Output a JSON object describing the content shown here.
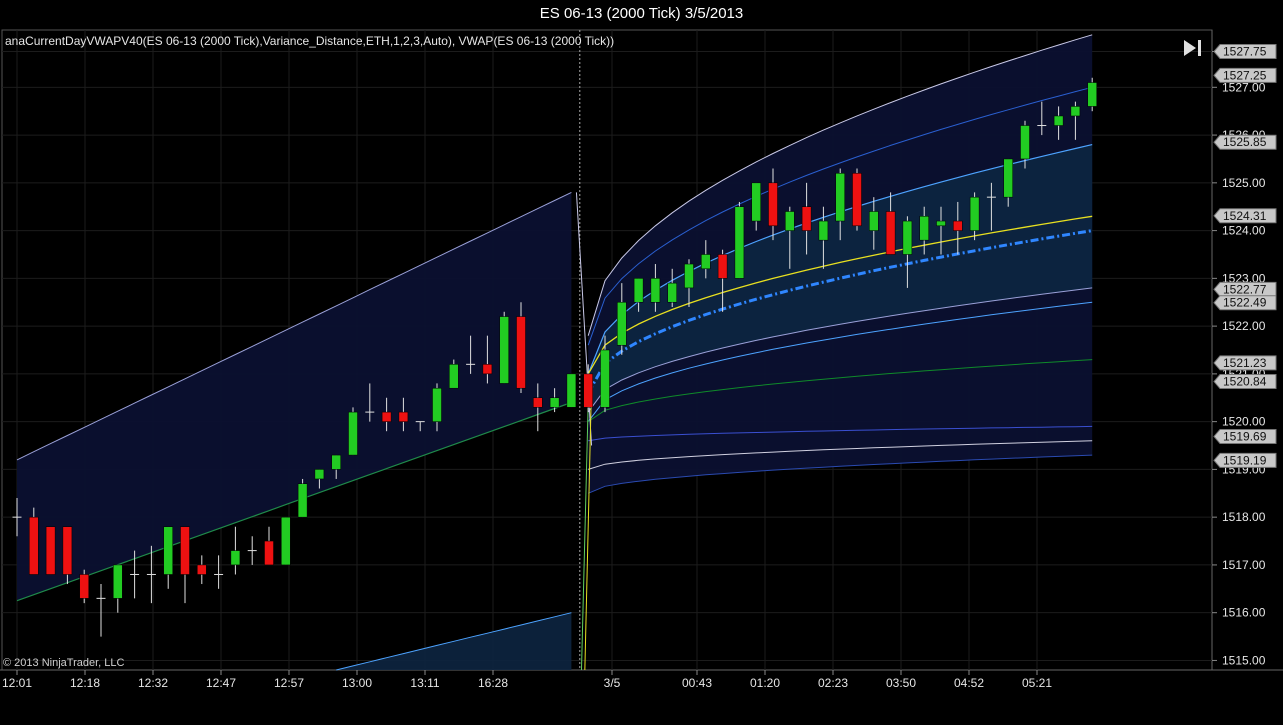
{
  "window": {
    "title": "ES 06-13 (2000 Tick)  3/5/2013"
  },
  "indicator_label": "anaCurrentDayVWAPV40(ES 06-13 (2000 Tick),Variance_Distance,ETH,1,2,3,Auto), VWAP(ES 06-13 (2000 Tick))",
  "copyright": "© 2013 NinjaTrader, LLC",
  "icons": {
    "scroll_end": "skip-to-end-icon"
  },
  "colors": {
    "background": "#000000",
    "up_candle": "#22cc22",
    "down_candle": "#ee1111",
    "vwap": "#2f86ff",
    "vwap_yellow": "#e8e020",
    "band_fill": "#0b1030",
    "inner_fill": "#0d2540"
  },
  "chart_data": {
    "type": "candlestick",
    "title": "ES 06-13 (2000 Tick)  3/5/2013",
    "ylim": [
      1514.8,
      1528.2
    ],
    "y_ticks": [
      "1515.00",
      "1516.00",
      "1517.00",
      "1518.00",
      "1519.00",
      "1520.00",
      "1521.00",
      "1522.00",
      "1523.00",
      "1524.00",
      "1525.00",
      "1526.00",
      "1527.00",
      "1527.75"
    ],
    "x_ticks": [
      "12:01",
      "12:18",
      "12:32",
      "12:47",
      "12:57",
      "13:00",
      "13:11",
      "16:28",
      "3/5",
      "00:43",
      "01:20",
      "02:23",
      "03:50",
      "04:52",
      "05:21"
    ],
    "session_break_index": 33.5,
    "candles": [
      {
        "o": 1518.0,
        "h": 1518.4,
        "l": 1517.6,
        "c": 1518.0
      },
      {
        "o": 1518.0,
        "h": 1518.2,
        "l": 1516.8,
        "c": 1516.8
      },
      {
        "o": 1517.8,
        "h": 1517.8,
        "l": 1516.8,
        "c": 1516.8
      },
      {
        "o": 1517.8,
        "h": 1517.8,
        "l": 1516.6,
        "c": 1516.8
      },
      {
        "o": 1516.8,
        "h": 1516.9,
        "l": 1516.2,
        "c": 1516.3
      },
      {
        "o": 1516.3,
        "h": 1516.6,
        "l": 1515.5,
        "c": 1516.3
      },
      {
        "o": 1516.3,
        "h": 1517.0,
        "l": 1516.0,
        "c": 1517.0
      },
      {
        "o": 1516.8,
        "h": 1517.3,
        "l": 1516.3,
        "c": 1516.8
      },
      {
        "o": 1516.8,
        "h": 1517.4,
        "l": 1516.2,
        "c": 1516.8
      },
      {
        "o": 1516.8,
        "h": 1517.8,
        "l": 1516.5,
        "c": 1517.8
      },
      {
        "o": 1517.8,
        "h": 1517.8,
        "l": 1516.2,
        "c": 1516.8
      },
      {
        "o": 1517.0,
        "h": 1517.2,
        "l": 1516.6,
        "c": 1516.8
      },
      {
        "o": 1516.8,
        "h": 1517.2,
        "l": 1516.5,
        "c": 1516.8
      },
      {
        "o": 1517.0,
        "h": 1517.8,
        "l": 1516.8,
        "c": 1517.3
      },
      {
        "o": 1517.3,
        "h": 1517.6,
        "l": 1517.0,
        "c": 1517.3
      },
      {
        "o": 1517.5,
        "h": 1517.8,
        "l": 1517.0,
        "c": 1517.0
      },
      {
        "o": 1517.0,
        "h": 1518.0,
        "l": 1517.0,
        "c": 1518.0
      },
      {
        "o": 1518.0,
        "h": 1518.8,
        "l": 1518.0,
        "c": 1518.7
      },
      {
        "o": 1518.8,
        "h": 1519.0,
        "l": 1518.6,
        "c": 1519.0
      },
      {
        "o": 1519.0,
        "h": 1519.3,
        "l": 1518.8,
        "c": 1519.3
      },
      {
        "o": 1519.3,
        "h": 1520.3,
        "l": 1519.3,
        "c": 1520.2
      },
      {
        "o": 1520.2,
        "h": 1520.8,
        "l": 1520.0,
        "c": 1520.2
      },
      {
        "o": 1520.2,
        "h": 1520.5,
        "l": 1519.8,
        "c": 1520.0
      },
      {
        "o": 1520.2,
        "h": 1520.5,
        "l": 1519.8,
        "c": 1520.0
      },
      {
        "o": 1520.0,
        "h": 1520.0,
        "l": 1519.8,
        "c": 1520.0
      },
      {
        "o": 1520.0,
        "h": 1520.8,
        "l": 1519.8,
        "c": 1520.7
      },
      {
        "o": 1520.7,
        "h": 1521.3,
        "l": 1520.7,
        "c": 1521.2
      },
      {
        "o": 1521.2,
        "h": 1521.8,
        "l": 1521.0,
        "c": 1521.2
      },
      {
        "o": 1521.2,
        "h": 1521.8,
        "l": 1520.8,
        "c": 1521.0
      },
      {
        "o": 1520.8,
        "h": 1522.3,
        "l": 1520.8,
        "c": 1522.2
      },
      {
        "o": 1522.2,
        "h": 1522.5,
        "l": 1520.6,
        "c": 1520.7
      },
      {
        "o": 1520.5,
        "h": 1520.8,
        "l": 1519.8,
        "c": 1520.3
      },
      {
        "o": 1520.3,
        "h": 1520.7,
        "l": 1520.2,
        "c": 1520.5
      },
      {
        "o": 1520.3,
        "h": 1521.0,
        "l": 1520.3,
        "c": 1521.0
      },
      {
        "o": 1521.0,
        "h": 1521.2,
        "l": 1520.2,
        "c": 1520.3
      },
      {
        "o": 1520.3,
        "h": 1521.8,
        "l": 1520.2,
        "c": 1521.5
      },
      {
        "o": 1521.6,
        "h": 1522.9,
        "l": 1521.4,
        "c": 1522.5
      },
      {
        "o": 1522.5,
        "h": 1523.0,
        "l": 1522.3,
        "c": 1523.0
      },
      {
        "o": 1522.5,
        "h": 1523.3,
        "l": 1522.3,
        "c": 1523.0
      },
      {
        "o": 1522.5,
        "h": 1523.2,
        "l": 1522.4,
        "c": 1522.9
      },
      {
        "o": 1522.8,
        "h": 1523.4,
        "l": 1522.4,
        "c": 1523.3
      },
      {
        "o": 1523.2,
        "h": 1523.8,
        "l": 1523.0,
        "c": 1523.5
      },
      {
        "o": 1523.5,
        "h": 1523.6,
        "l": 1522.3,
        "c": 1523.0
      },
      {
        "o": 1523.0,
        "h": 1524.6,
        "l": 1523.0,
        "c": 1524.5
      },
      {
        "o": 1524.2,
        "h": 1525.0,
        "l": 1524.0,
        "c": 1525.0
      },
      {
        "o": 1525.0,
        "h": 1525.3,
        "l": 1523.8,
        "c": 1524.1
      },
      {
        "o": 1524.0,
        "h": 1524.5,
        "l": 1523.2,
        "c": 1524.4
      },
      {
        "o": 1524.5,
        "h": 1525.0,
        "l": 1523.5,
        "c": 1524.0
      },
      {
        "o": 1523.8,
        "h": 1524.5,
        "l": 1523.2,
        "c": 1524.2
      },
      {
        "o": 1524.2,
        "h": 1525.3,
        "l": 1523.8,
        "c": 1525.2
      },
      {
        "o": 1525.2,
        "h": 1525.3,
        "l": 1524.0,
        "c": 1524.1
      },
      {
        "o": 1524.0,
        "h": 1524.7,
        "l": 1523.6,
        "c": 1524.4
      },
      {
        "o": 1524.4,
        "h": 1524.8,
        "l": 1523.5,
        "c": 1523.5
      },
      {
        "o": 1523.5,
        "h": 1524.3,
        "l": 1522.8,
        "c": 1524.2
      },
      {
        "o": 1523.8,
        "h": 1524.5,
        "l": 1523.5,
        "c": 1524.3
      },
      {
        "o": 1524.1,
        "h": 1524.5,
        "l": 1523.5,
        "c": 1524.2
      },
      {
        "o": 1524.2,
        "h": 1524.6,
        "l": 1523.5,
        "c": 1524.0
      },
      {
        "o": 1524.0,
        "h": 1524.8,
        "l": 1523.8,
        "c": 1524.7
      },
      {
        "o": 1524.7,
        "h": 1525.0,
        "l": 1524.0,
        "c": 1524.7
      },
      {
        "o": 1524.7,
        "h": 1525.5,
        "l": 1524.5,
        "c": 1525.5
      },
      {
        "o": 1525.5,
        "h": 1526.3,
        "l": 1525.3,
        "c": 1526.2
      },
      {
        "o": 1526.2,
        "h": 1526.7,
        "l": 1526.0,
        "c": 1526.2
      },
      {
        "o": 1526.2,
        "h": 1526.6,
        "l": 1525.9,
        "c": 1526.4
      },
      {
        "o": 1526.4,
        "h": 1526.7,
        "l": 1525.9,
        "c": 1526.6
      },
      {
        "o": 1526.6,
        "h": 1527.2,
        "l": 1526.5,
        "c": 1527.1
      }
    ],
    "price_markers": [
      {
        "label": "1527.75",
        "value": 1527.75
      },
      {
        "label": "1527.25",
        "value": 1527.25
      },
      {
        "label": "1525.85",
        "value": 1525.85
      },
      {
        "label": "1524.31",
        "value": 1524.31
      },
      {
        "label": "1522.77",
        "value": 1522.77
      },
      {
        "label": "1522.49",
        "value": 1522.49
      },
      {
        "label": "1521.23",
        "value": 1521.23
      },
      {
        "label": "1520.84",
        "value": 1520.84
      },
      {
        "label": "1519.69",
        "value": 1519.69
      },
      {
        "label": "1519.19",
        "value": 1519.19
      }
    ]
  }
}
